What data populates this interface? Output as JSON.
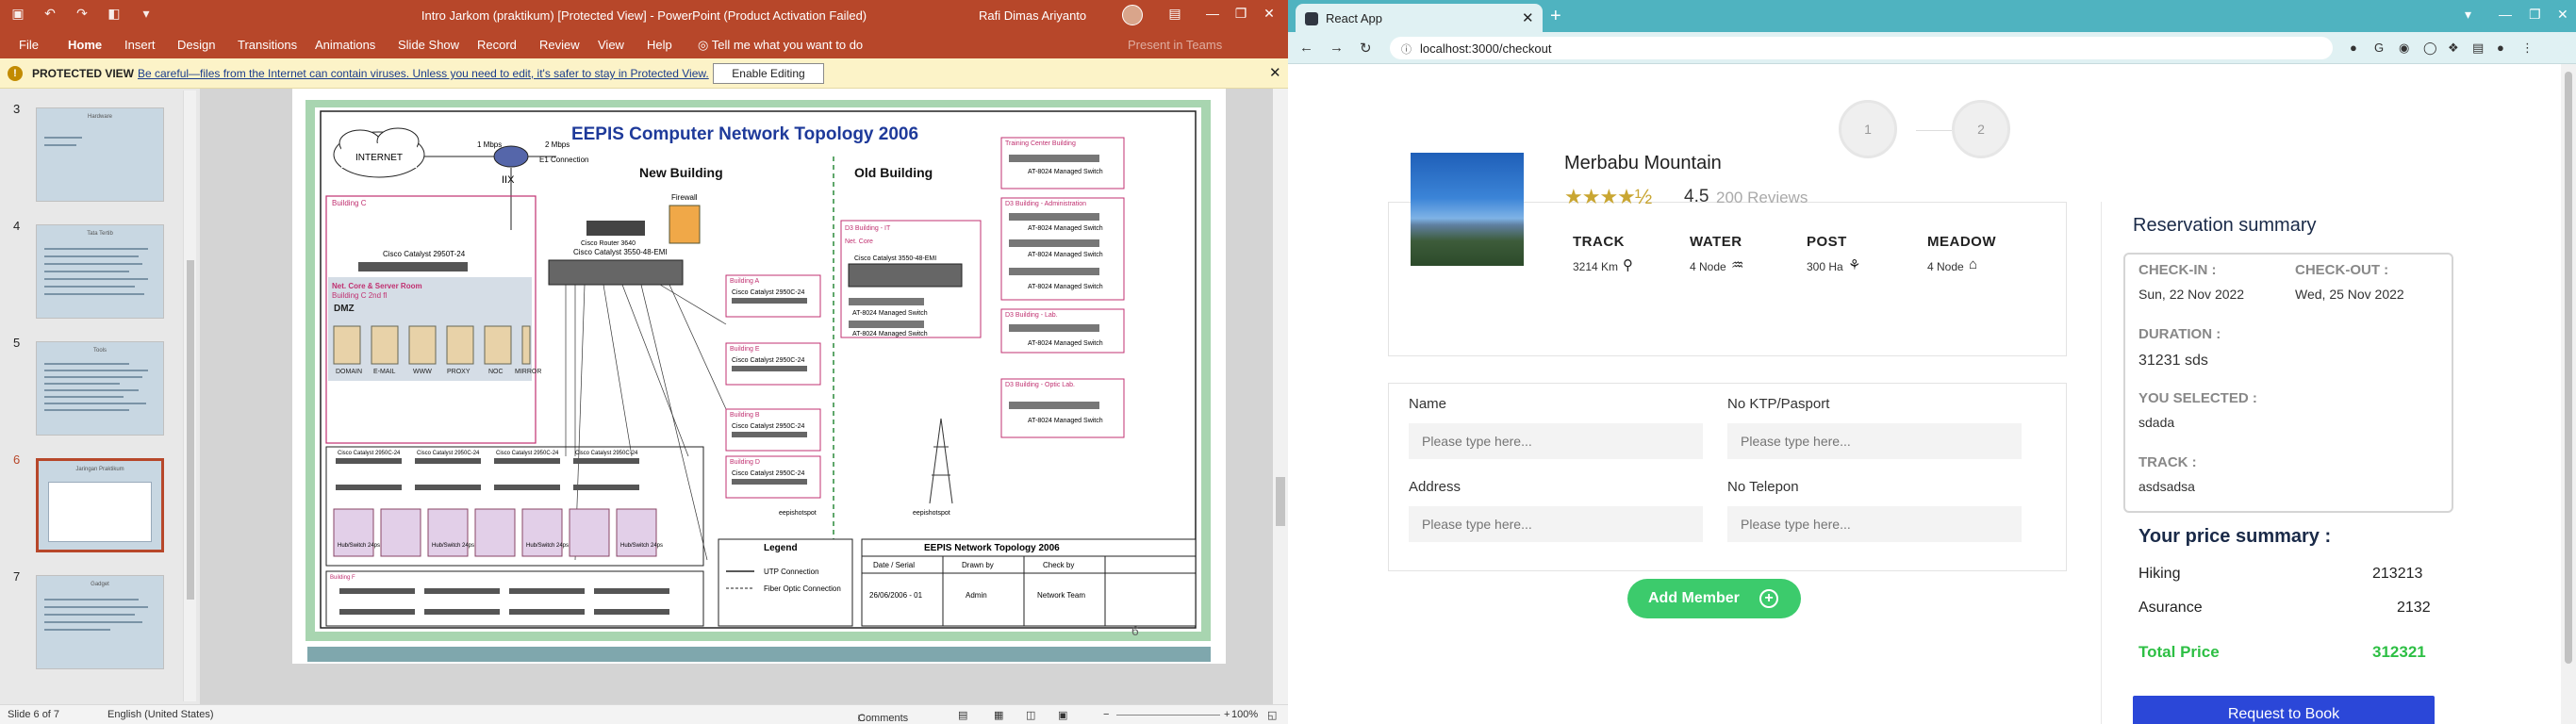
{
  "ppt": {
    "doc_title": "Intro Jarkom (praktikum) [Protected View]  -  PowerPoint (Product Activation Failed)",
    "user_name": "Rafi Dimas Ariyanto",
    "menu": [
      "File",
      "Home",
      "Insert",
      "Design",
      "Transitions",
      "Animations",
      "Slide Show",
      "Record",
      "Review",
      "View",
      "Help"
    ],
    "tell_me": "Tell me what you want to do",
    "present": "Present in Teams",
    "protected_label": "PROTECTED VIEW",
    "protected_msg": "Be careful—files from the Internet can contain viruses. Unless you need to edit, it's safer to stay in Protected View.",
    "enable_btn": "Enable Editing",
    "thumbs": [
      {
        "num": "3",
        "title": "Hardware"
      },
      {
        "num": "4",
        "title": "Tata Tertib"
      },
      {
        "num": "5",
        "title": "Tools"
      },
      {
        "num": "6",
        "title": "Jaringan Praktikum"
      },
      {
        "num": "7",
        "title": "Gadget"
      }
    ],
    "status": {
      "slide": "Slide 6 of 7",
      "lang": "English (United States)",
      "comments": "Comments",
      "zoom": "100%"
    }
  },
  "slide": {
    "title": "EEPIS Computer Network Topology 2006",
    "new_building": "New Building",
    "old_building": "Old Building",
    "internet": "INTERNET",
    "mbps1": "1 Mbps",
    "mbps2": "2 Mbps",
    "e1": "E1 Connection",
    "iix": "IIX",
    "firewall": "Firewall",
    "router": "Cisco Router 3640",
    "building_c": "Building C",
    "cat2950t": "Cisco Catalyst 2950T-24",
    "cat3550_1": "Cisco Catalyst 3550-48-EMI",
    "cat3550_2": "Cisco Catalyst 3550-48-EMI",
    "dmz_title": "Net. Core & Server Room",
    "dmz_sub": "Building C 2nd fl",
    "dmz": "DMZ",
    "servers": [
      "DOMAIN",
      "E-MAIL",
      "WWW",
      "PROXY",
      "NOC",
      "MIRROR"
    ],
    "net_core": "Net. Core",
    "bld_it": "D3 Building - IT",
    "at8024": "AT-8024 Managed Switch",
    "training": "Training Center Building",
    "admin": "D3 Building - Administration",
    "lab": "D3 Building - Lab.",
    "optic": "D3 Building - Optic Lab.",
    "bld_a": "Building A",
    "bld_e": "Building E",
    "bld_b": "Building B",
    "bld_d": "Building D",
    "bld_f": "Building F",
    "cat2950c": "Cisco Catalyst 2950C-24",
    "hotspot": "eepishotspot",
    "hub": "Hub/Switch 24ps",
    "legend": "Legend",
    "utp": "UTP Connection",
    "fiber": "Fiber Optic Connection",
    "eepis_title": "EEPIS Network Topology 2006",
    "col_date": "Date / Serial",
    "col_drawn": "Drawn by",
    "col_check": "Check by",
    "v_date": "26/06/2006 - 01",
    "v_drawn": "Admin",
    "v_check": "Network Team",
    "page_num": "6"
  },
  "browser": {
    "tab_title": "React App",
    "url": "localhost:3000/checkout",
    "steps": [
      "1",
      "2"
    ]
  },
  "checkout": {
    "mountain": "Merbabu Mountain",
    "stars": "★★★★½",
    "rating": "4.5",
    "reviews": "200 Reviews",
    "features": [
      {
        "label": "TRACK",
        "value": "3214 Km",
        "icon": "⚲"
      },
      {
        "label": "WATER",
        "value": "4 Node",
        "icon": "♒"
      },
      {
        "label": "POST",
        "value": "300 Ha",
        "icon": "⚘"
      },
      {
        "label": "MEADOW",
        "value": "4 Node",
        "icon": "⌂"
      }
    ],
    "form": {
      "name_label": "Name",
      "ktp_label": "No KTP/Pasport",
      "address_label": "Address",
      "phone_label": "No Telepon",
      "placeholder": "Please type here..."
    },
    "add_member": "Add Member",
    "summary": {
      "title": "Reservation summary",
      "checkin_label": "CHECK-IN :",
      "checkin": "Sun, 22 Nov 2022",
      "checkout_label": "CHECK-OUT :",
      "checkout": "Wed, 25 Nov 2022",
      "duration_label": "DURATION :",
      "duration": "31231 sds",
      "selected_label": "YOU SELECTED :",
      "selected": "sdada",
      "track_label": "TRACK :",
      "track": "asdsadsa"
    },
    "price": {
      "title": "Your price summary :",
      "rows": [
        {
          "label": "Hiking",
          "value": "213213"
        },
        {
          "label": "Asurance",
          "value": "2132"
        }
      ],
      "total_label": "Total Price",
      "total": "312321"
    },
    "request_btn": "Request to Book"
  },
  "colors": {
    "ppt_red": "#b7472a",
    "green": "#3ccb6c",
    "blue": "#2b47d8",
    "teal": "#4fb3c0"
  }
}
